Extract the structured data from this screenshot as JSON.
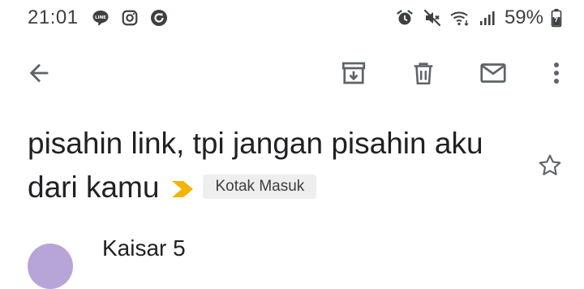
{
  "status_bar": {
    "time": "21:01",
    "battery": "59%",
    "notification_icons": [
      "line-icon",
      "instagram-icon",
      "sync-icon"
    ],
    "system_icons": [
      "alarm-icon",
      "mute-icon",
      "wifi-icon",
      "signal-icon",
      "battery-icon"
    ]
  },
  "toolbar": {
    "back_icon": "arrow-left-icon",
    "actions": [
      "archive-icon",
      "delete-icon",
      "mark-unread-icon",
      "more-vert-icon"
    ]
  },
  "email": {
    "subject": "pisahin link, tpi jangan pisahin aku dari kamu",
    "label": "Kotak Masuk",
    "importance_color": "#f4b400",
    "starred": false,
    "sender_name": "Kaisar 5"
  },
  "colors": {
    "icon": "#5f6368",
    "text": "#202124",
    "chip_bg": "#eeeeee"
  }
}
